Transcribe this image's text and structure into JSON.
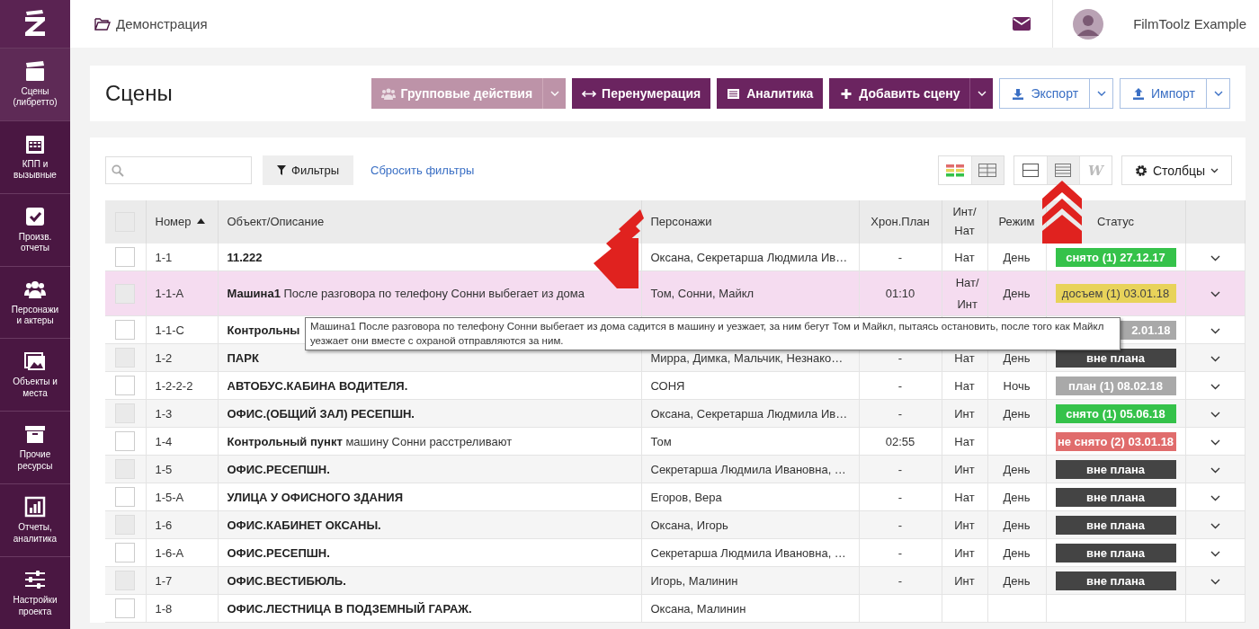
{
  "sidebar": {
    "items": [
      {
        "label": "Сцены (либретто)",
        "selected": true
      },
      {
        "label": "КПП и вызывные",
        "selected": false
      },
      {
        "label": "Произв. отчеты",
        "selected": false
      },
      {
        "label": "Персонажи и актеры",
        "selected": false
      },
      {
        "label": "Объекты и места",
        "selected": false
      },
      {
        "label": "Прочие ресурсы",
        "selected": false
      },
      {
        "label": "Отчеты, аналитика",
        "selected": false
      },
      {
        "label": "Настройки проекта",
        "selected": false
      }
    ]
  },
  "topbar": {
    "project": "Демонстрация",
    "user": "FilmToolz Example"
  },
  "header": {
    "title": "Сцены",
    "buttons": [
      {
        "label": "Групповые действия",
        "kind": "group",
        "disabled": true,
        "split": true
      },
      {
        "label": "Перенумерация",
        "kind": "renumber",
        "disabled": false,
        "split": false
      },
      {
        "label": "Аналитика",
        "kind": "analytics",
        "disabled": false,
        "split": false
      },
      {
        "label": "Добавить сцену",
        "kind": "add",
        "disabled": false,
        "split": true
      },
      {
        "label": "Экспорт",
        "kind": "export",
        "disabled": false,
        "split": true
      },
      {
        "label": "Импорт",
        "kind": "import",
        "disabled": false,
        "split": true
      }
    ]
  },
  "toolbar": {
    "filters": "Фильтры",
    "reset": "Сбросить фильтры",
    "color_views": [
      {
        "selected": false
      },
      {
        "selected": true
      }
    ],
    "row_views": [
      {
        "selected": false
      },
      {
        "selected": true
      },
      {
        "selected": false
      }
    ],
    "row_view_w": "W",
    "columns": "Столбцы"
  },
  "table": {
    "select_all": {
      "checked": false
    },
    "columns": [
      "Номер",
      "Объект/Описание",
      "Персонажи",
      "Хрон.План",
      "Инт/ Нат",
      "Режим",
      "Статус"
    ],
    "rows": [
      {
        "checked": false,
        "number": "1-1",
        "title": "11.222",
        "text": "",
        "characters": "Оксана, Секретарша Людмила Ив…",
        "chron": "-",
        "int_nat": "Нат",
        "regime": "День",
        "status": "снято (1) 27.12.17",
        "color": "#35c24a",
        "selected": false
      },
      {
        "checked": false,
        "number": "1-1-A",
        "title": "Машина1",
        "text": "После разговора по телефону Сонни выбегает из дома",
        "characters": "Том, Сонни, Майкл",
        "chron": "01:10",
        "int_nat": "Нат/ Инт",
        "regime": "День",
        "status": "досъем (1) 03.01.18",
        "color": "#e8d35a",
        "selected": true
      },
      {
        "checked": false,
        "number": "1-1-C",
        "title": "Контрольны",
        "text": "",
        "characters": "",
        "chron": "",
        "int_nat": "",
        "regime": "",
        "status": "2.01.18",
        "color": "#a9a9a9",
        "selected": false
      },
      {
        "checked": false,
        "number": "1-2",
        "title": "ПАРК",
        "text": "",
        "characters": "Мирра, Димка, Мальчик, Незнако…",
        "chron": "-",
        "int_nat": "Нат",
        "regime": "День",
        "status": "вне плана",
        "color": "#444444",
        "selected": false
      },
      {
        "checked": false,
        "number": "1-2-2-2",
        "title": "АВТОБУС.КАБИНА ВОДИТЕЛЯ.",
        "text": "",
        "characters": "СОНЯ",
        "chron": "-",
        "int_nat": "Нат",
        "regime": "Ночь",
        "status": "план (1) 08.02.18",
        "color": "#a9a9a9",
        "selected": false
      },
      {
        "checked": false,
        "number": "1-3",
        "title": "ОФИС.(ОБЩИЙ ЗАЛ) РЕСЕПШН.",
        "text": "",
        "characters": "Оксана, Секретарша Людмила Ив…",
        "chron": "-",
        "int_nat": "Инт",
        "regime": "День",
        "status": "снято (1) 05.06.18",
        "color": "#35c24a",
        "selected": false
      },
      {
        "checked": false,
        "number": "1-4",
        "title": "Контрольный пункт",
        "text": "машину Сонни расстреливают",
        "characters": "Том",
        "chron": "02:55",
        "int_nat": "Нат",
        "regime": "",
        "status": "не снято (2) 03.01.18",
        "color": "#e06c6c",
        "selected": false
      },
      {
        "checked": false,
        "number": "1-5",
        "title": "ОФИС.РЕСЕПШН.",
        "text": "",
        "characters": "Секретарша Людмила Ивановна, …",
        "chron": "-",
        "int_nat": "Инт",
        "regime": "День",
        "status": "вне плана",
        "color": "#444444",
        "selected": false
      },
      {
        "checked": false,
        "number": "1-5-A",
        "title": "УЛИЦА У ОФИСНОГО ЗДАНИЯ",
        "text": "",
        "characters": "Егоров, Вера",
        "chron": "-",
        "int_nat": "Нат",
        "regime": "День",
        "status": "вне плана",
        "color": "#444444",
        "selected": false
      },
      {
        "checked": false,
        "number": "1-6",
        "title": "ОФИС.КАБИНЕТ ОКСАНЫ.",
        "text": "",
        "characters": "Оксана, Игорь",
        "chron": "-",
        "int_nat": "Инт",
        "regime": "День",
        "status": "вне плана",
        "color": "#444444",
        "selected": false
      },
      {
        "checked": false,
        "number": "1-6-A",
        "title": "ОФИС.РЕСЕПШН.",
        "text": "",
        "characters": "Секретарша Людмила Ивановна, …",
        "chron": "-",
        "int_nat": "Инт",
        "regime": "День",
        "status": "вне плана",
        "color": "#444444",
        "selected": false
      },
      {
        "checked": false,
        "number": "1-7",
        "title": "ОФИС.ВЕСТИБЮЛЬ.",
        "text": "",
        "characters": "Игорь, Малинин",
        "chron": "-",
        "int_nat": "Инт",
        "regime": "День",
        "status": "вне плана",
        "color": "#444444",
        "selected": false
      },
      {
        "checked": false,
        "number": "1-8",
        "title": "ОФИС.ЛЕСТНИЦА В ПОДЗЕМНЫЙ ГАРАЖ.",
        "text": "",
        "characters": "Оксана, Малинин",
        "chron": "",
        "int_nat": "",
        "regime": "",
        "status": "",
        "selected": false
      }
    ],
    "tooltip": "Машина1 После разговора по телефону Сонни выбегает из дома садится в машину и уезжает, за ним бегут Том и Майкл, пытаясь остановить, после того как Майкл уезжает они вместе с охраной отправляются за ним."
  }
}
